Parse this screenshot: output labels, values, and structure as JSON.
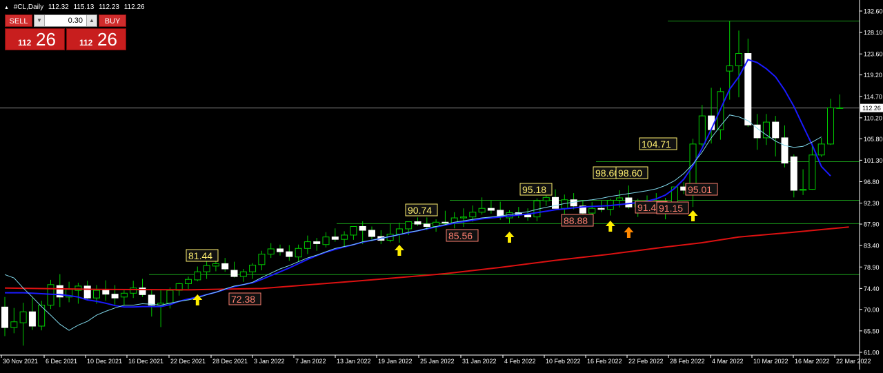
{
  "header": {
    "symbol": "#CL,Daily",
    "open": "112.32",
    "high": "115.13",
    "low": "112.23",
    "close": "112.26"
  },
  "trade_panel": {
    "sell_label": "SELL",
    "buy_label": "BUY",
    "lot": "0.30",
    "sell_price_small": "112",
    "sell_price_big": "26",
    "buy_price_small": "112",
    "buy_price_big": "26"
  },
  "chart_data": {
    "type": "candlestick",
    "symbol": "#CL",
    "timeframe": "Daily",
    "y_ticks": [
      "132.60",
      "128.10",
      "123.60",
      "119.20",
      "114.70",
      "110.20",
      "105.80",
      "101.30",
      "96.80",
      "92.30",
      "87.90",
      "83.40",
      "78.90",
      "74.40",
      "70.00",
      "65.50",
      "61.00"
    ],
    "current_price": "112.26",
    "x_ticks": [
      "30 Nov 2021",
      "6 Dec 2021",
      "10 Dec 2021",
      "16 Dec 2021",
      "22 Dec 2021",
      "28 Dec 2021",
      "3 Jan 2022",
      "7 Jan 2022",
      "13 Jan 2022",
      "19 Jan 2022",
      "25 Jan 2022",
      "31 Jan 2022",
      "4 Feb 2022",
      "10 Feb 2022",
      "16 Feb 2022",
      "22 Feb 2022",
      "28 Feb 2022",
      "4 Mar 2022",
      "10 Mar 2022",
      "16 Mar 2022",
      "22 Mar 2022"
    ],
    "candles": [
      [
        70.5,
        72.6,
        64.4,
        66.2
      ],
      [
        66.2,
        70.3,
        65.0,
        67.4
      ],
      [
        67.2,
        71.4,
        62.4,
        69.5
      ],
      [
        69.5,
        72.4,
        65.7,
        66.5
      ],
      [
        66.5,
        71.8,
        65.6,
        70.9
      ],
      [
        70.9,
        76.2,
        70.1,
        75.2
      ],
      [
        75.0,
        77.4,
        70.5,
        72.6
      ],
      [
        72.6,
        75.8,
        71.5,
        74.2
      ],
      [
        74.0,
        75.6,
        71.2,
        74.9
      ],
      [
        74.9,
        76.0,
        72.0,
        72.4
      ],
      [
        72.4,
        75.1,
        71.2,
        74.0
      ],
      [
        74.0,
        76.1,
        71.8,
        73.2
      ],
      [
        73.2,
        75.1,
        71.0,
        72.4
      ],
      [
        72.6,
        74.0,
        70.8,
        73.4
      ],
      [
        73.4,
        76.0,
        72.4,
        74.5
      ],
      [
        74.5,
        76.4,
        72.6,
        73.1
      ],
      [
        73.0,
        74.0,
        68.5,
        70.9
      ],
      [
        70.9,
        74.2,
        66.3,
        71.3
      ],
      [
        71.3,
        74.6,
        70.2,
        74.0
      ],
      [
        74.0,
        75.6,
        72.9,
        75.4
      ],
      [
        75.4,
        76.9,
        74.3,
        76.3
      ],
      [
        76.2,
        79.0,
        75.9,
        77.9
      ],
      [
        77.9,
        80.2,
        76.4,
        79.2
      ],
      [
        79.1,
        80.5,
        78.0,
        79.6
      ],
      [
        79.6,
        80.8,
        77.9,
        78.5
      ],
      [
        78.2,
        80.0,
        76.7,
        76.9
      ],
      [
        76.9,
        78.5,
        75.8,
        77.9
      ],
      [
        77.9,
        79.7,
        76.4,
        79.3
      ],
      [
        79.4,
        82.3,
        78.2,
        81.6
      ],
      [
        81.6,
        83.9,
        80.8,
        82.7
      ],
      [
        82.7,
        83.6,
        81.3,
        82.1
      ],
      [
        82.1,
        83.5,
        80.2,
        81.1
      ],
      [
        81.0,
        83.6,
        80.0,
        82.8
      ],
      [
        82.8,
        85.5,
        81.6,
        84.2
      ],
      [
        84.2,
        85.0,
        82.3,
        83.8
      ],
      [
        83.6,
        86.2,
        83.0,
        85.2
      ],
      [
        85.2,
        87.0,
        84.2,
        84.7
      ],
      [
        84.7,
        86.4,
        83.2,
        85.6
      ],
      [
        85.6,
        87.2,
        84.6,
        87.4
      ],
      [
        87.4,
        88.5,
        83.7,
        86.6
      ],
      [
        86.6,
        87.4,
        84.3,
        85.3
      ],
      [
        85.3,
        86.6,
        83.7,
        84.5
      ],
      [
        84.5,
        88.0,
        84.1,
        85.8
      ],
      [
        85.8,
        88.2,
        84.0,
        86.9
      ],
      [
        86.9,
        88.3,
        85.6,
        88.4
      ],
      [
        88.4,
        89.3,
        87.5,
        87.9
      ],
      [
        87.9,
        89.3,
        86.6,
        87.4
      ],
      [
        87.4,
        88.9,
        86.3,
        88.3
      ],
      [
        88.3,
        90.7,
        87.8,
        88.2
      ],
      [
        88.2,
        90.4,
        87.0,
        89.2
      ],
      [
        89.2,
        91.2,
        87.3,
        89.4
      ],
      [
        89.4,
        91.8,
        88.4,
        90.4
      ],
      [
        90.4,
        93.5,
        89.9,
        91.2
      ],
      [
        91.2,
        92.9,
        90.1,
        90.8
      ],
      [
        90.8,
        92.6,
        88.8,
        89.6
      ],
      [
        89.2,
        90.8,
        88.1,
        90.3
      ],
      [
        90.3,
        91.5,
        89.2,
        89.8
      ],
      [
        89.8,
        91.2,
        88.6,
        89.4
      ],
      [
        89.4,
        93.3,
        88.5,
        92.8
      ],
      [
        92.8,
        94.8,
        91.7,
        93.5
      ],
      [
        93.5,
        95.2,
        91.5,
        91.2
      ],
      [
        91.2,
        94.1,
        89.2,
        93.0
      ],
      [
        93.0,
        94.4,
        91.0,
        91.7
      ],
      [
        91.7,
        92.9,
        89.8,
        90.2
      ],
      [
        90.2,
        92.5,
        88.7,
        91.2
      ],
      [
        91.2,
        92.8,
        90.4,
        91.0
      ],
      [
        91.0,
        93.2,
        89.7,
        92.9
      ],
      [
        92.9,
        95.0,
        91.4,
        93.4
      ],
      [
        93.4,
        96.0,
        91.1,
        91.5
      ],
      [
        91.5,
        93.2,
        89.4,
        92.6
      ],
      [
        92.6,
        93.9,
        90.9,
        91.9
      ],
      [
        91.9,
        94.4,
        91.0,
        92.3
      ],
      [
        92.3,
        93.4,
        88.9,
        91.0
      ],
      [
        91.0,
        95.4,
        90.5,
        95.7
      ],
      [
        95.7,
        96.7,
        94.2,
        95.0
      ],
      [
        95.0,
        105.8,
        91.5,
        104.7
      ],
      [
        104.7,
        112.9,
        104.2,
        110.6
      ],
      [
        110.6,
        116.5,
        104.8,
        107.7
      ],
      [
        107.7,
        116.5,
        105.6,
        115.7
      ],
      [
        120.0,
        130.5,
        114.0,
        121.1
      ],
      [
        121.1,
        128.5,
        114.5,
        123.7
      ],
      [
        123.7,
        126.8,
        108.3,
        108.7
      ],
      [
        108.7,
        111.0,
        103.5,
        106.0
      ],
      [
        106.0,
        111.0,
        104.5,
        109.3
      ],
      [
        109.3,
        110.6,
        102.1,
        106.0
      ],
      [
        106.0,
        108.6,
        99.8,
        100.7
      ],
      [
        102.0,
        102.5,
        93.5,
        95.0
      ],
      [
        95.0,
        99.4,
        94.0,
        95.2
      ],
      [
        95.2,
        104.8,
        95.1,
        102.4
      ],
      [
        102.4,
        106.0,
        102.0,
        104.7
      ],
      [
        104.7,
        114.2,
        104.5,
        112.3
      ],
      [
        112.3,
        115.1,
        112.2,
        112.3
      ]
    ],
    "ma_fast": [
      [
        0,
        77.3
      ],
      [
        1,
        76.6
      ],
      [
        2,
        74.5
      ],
      [
        3,
        72.6
      ],
      [
        4,
        70.6
      ],
      [
        5,
        68.8
      ],
      [
        6,
        66.9
      ],
      [
        7,
        65.6
      ],
      [
        8,
        66.7
      ],
      [
        9,
        67.5
      ],
      [
        10,
        68.8
      ],
      [
        11,
        69.6
      ],
      [
        12,
        70.3
      ],
      [
        13,
        70.9
      ],
      [
        14,
        70.9
      ],
      [
        15,
        71.2
      ],
      [
        16,
        71.1
      ],
      [
        17,
        70.9
      ],
      [
        18,
        71.3
      ],
      [
        19,
        71.7
      ],
      [
        20,
        72.0
      ],
      [
        21,
        72.4
      ],
      [
        22,
        73.1
      ],
      [
        23,
        73.6
      ],
      [
        24,
        74.3
      ],
      [
        25,
        74.9
      ],
      [
        26,
        75.2
      ],
      [
        27,
        75.7
      ],
      [
        28,
        76.7
      ],
      [
        29,
        77.6
      ],
      [
        30,
        78.5
      ],
      [
        31,
        79.2
      ],
      [
        32,
        80.0
      ],
      [
        33,
        80.8
      ],
      [
        34,
        81.4
      ],
      [
        35,
        82.1
      ],
      [
        36,
        82.8
      ],
      [
        37,
        83.2
      ],
      [
        38,
        83.6
      ],
      [
        39,
        84.2
      ],
      [
        40,
        84.5
      ],
      [
        41,
        84.9
      ],
      [
        42,
        85.3
      ],
      [
        43,
        85.7
      ],
      [
        44,
        86.2
      ],
      [
        45,
        86.5
      ],
      [
        46,
        87.0
      ],
      [
        47,
        87.4
      ],
      [
        48,
        87.8
      ],
      [
        49,
        88.3
      ],
      [
        50,
        88.6
      ],
      [
        51,
        88.9
      ],
      [
        52,
        89.2
      ],
      [
        53,
        89.4
      ],
      [
        54,
        89.6
      ],
      [
        55,
        89.9
      ],
      [
        56,
        90.2
      ],
      [
        57,
        90.5
      ],
      [
        58,
        91.0
      ],
      [
        59,
        91.4
      ],
      [
        60,
        91.8
      ],
      [
        61,
        92.2
      ],
      [
        62,
        92.5
      ],
      [
        63,
        92.8
      ],
      [
        64,
        93.0
      ],
      [
        65,
        93.3
      ],
      [
        66,
        93.7
      ],
      [
        67,
        94.0
      ],
      [
        68,
        94.3
      ],
      [
        69,
        94.6
      ],
      [
        70,
        94.9
      ],
      [
        71,
        95.3
      ],
      [
        72,
        96.0
      ],
      [
        73,
        97.0
      ],
      [
        74,
        98.5
      ],
      [
        75,
        100.5
      ],
      [
        76,
        103.0
      ],
      [
        77,
        106.0
      ],
      [
        78,
        108.5
      ],
      [
        79,
        110.8
      ],
      [
        80,
        110.4
      ],
      [
        81,
        109.6
      ],
      [
        82,
        108.0
      ],
      [
        83,
        106.6
      ],
      [
        84,
        105.3
      ],
      [
        85,
        104.4
      ],
      [
        86,
        104.0
      ],
      [
        87,
        104.2
      ],
      [
        88,
        105.1
      ],
      [
        89,
        106.2
      ]
    ],
    "ma_blue": [
      [
        0,
        73.5
      ],
      [
        1,
        73.5
      ],
      [
        2,
        73.5
      ],
      [
        3,
        73.4
      ],
      [
        4,
        73.3
      ],
      [
        5,
        73.2
      ],
      [
        6,
        73.1
      ],
      [
        7,
        72.9
      ],
      [
        8,
        72.6
      ],
      [
        9,
        72.0
      ],
      [
        10,
        71.7
      ],
      [
        11,
        71.3
      ],
      [
        12,
        70.8
      ],
      [
        13,
        70.5
      ],
      [
        14,
        70.5
      ],
      [
        15,
        70.6
      ],
      [
        16,
        70.6
      ],
      [
        17,
        70.6
      ],
      [
        18,
        71.0
      ],
      [
        19,
        71.7
      ],
      [
        20,
        72.2
      ],
      [
        21,
        72.6
      ],
      [
        22,
        73.1
      ],
      [
        23,
        73.6
      ],
      [
        24,
        74.2
      ],
      [
        25,
        74.8
      ],
      [
        26,
        75.2
      ],
      [
        27,
        75.6
      ],
      [
        28,
        76.3
      ],
      [
        29,
        77.1
      ],
      [
        30,
        77.9
      ],
      [
        31,
        78.7
      ],
      [
        32,
        79.6
      ],
      [
        33,
        80.5
      ],
      [
        34,
        81.3
      ],
      [
        35,
        82.0
      ],
      [
        36,
        82.6
      ],
      [
        37,
        83.1
      ],
      [
        38,
        83.6
      ],
      [
        39,
        84.1
      ],
      [
        40,
        84.5
      ],
      [
        41,
        84.9
      ],
      [
        42,
        85.3
      ],
      [
        43,
        85.7
      ],
      [
        44,
        86.1
      ],
      [
        45,
        86.5
      ],
      [
        46,
        86.9
      ],
      [
        47,
        87.3
      ],
      [
        48,
        87.7
      ],
      [
        49,
        88.1
      ],
      [
        50,
        88.4
      ],
      [
        51,
        88.7
      ],
      [
        52,
        89.0
      ],
      [
        53,
        89.2
      ],
      [
        54,
        89.4
      ],
      [
        55,
        89.6
      ],
      [
        56,
        89.8
      ],
      [
        57,
        90.0
      ],
      [
        58,
        90.3
      ],
      [
        59,
        90.6
      ],
      [
        60,
        90.9
      ],
      [
        61,
        91.1
      ],
      [
        62,
        91.3
      ],
      [
        63,
        91.5
      ],
      [
        64,
        91.6
      ],
      [
        65,
        91.7
      ],
      [
        66,
        91.8
      ],
      [
        67,
        92.0
      ],
      [
        68,
        92.2
      ],
      [
        69,
        92.4
      ],
      [
        70,
        92.7
      ],
      [
        71,
        93.2
      ],
      [
        72,
        94.0
      ],
      [
        73,
        95.4
      ],
      [
        74,
        97.3
      ],
      [
        75,
        100.2
      ],
      [
        76,
        103.8
      ],
      [
        77,
        107.8
      ],
      [
        78,
        112.0
      ],
      [
        79,
        116.2
      ],
      [
        80,
        118.8
      ],
      [
        81,
        122.4
      ],
      [
        82,
        121.8
      ],
      [
        83,
        120.5
      ],
      [
        84,
        118.8
      ],
      [
        85,
        116.0
      ],
      [
        86,
        112.6
      ],
      [
        87,
        108.5
      ],
      [
        88,
        104.5
      ],
      [
        89,
        100.0
      ],
      [
        90,
        98.0
      ]
    ],
    "ma_red": [
      [
        0,
        74.5
      ],
      [
        10,
        74.2
      ],
      [
        20,
        74.1
      ],
      [
        28,
        74.4
      ],
      [
        32,
        75.0
      ],
      [
        40,
        76.2
      ],
      [
        48,
        77.5
      ],
      [
        54,
        78.8
      ],
      [
        60,
        80.3
      ],
      [
        66,
        81.6
      ],
      [
        72,
        83.1
      ],
      [
        76,
        84.0
      ],
      [
        80,
        85.2
      ],
      [
        86,
        86.2
      ],
      [
        92,
        87.3
      ]
    ],
    "hlines": [
      130.5,
      112.26,
      101.0,
      92.9,
      88.0,
      77.3
    ],
    "hline_left_start": [
      968,
      0,
      864,
      652,
      488,
      216
    ],
    "labels_yellow": [
      "81.44",
      "90.74",
      "95.18",
      "98.60",
      "98.60",
      "104.71"
    ],
    "labels_red": [
      "72.38",
      "85.56",
      "88.88",
      "91.40",
      "91.15",
      "95.01"
    ],
    "arrows": [
      {
        "color": "#ffee00",
        "at_candle": 21
      },
      {
        "color": "#ffee00",
        "at_candle": 43
      },
      {
        "color": "#ffee00",
        "at_candle": 55
      },
      {
        "color": "#ffee00",
        "at_candle": 66
      },
      {
        "color": "#ff8800",
        "at_candle": 68
      },
      {
        "color": "#ffee00",
        "at_candle": 75
      }
    ],
    "colors": {
      "bull_body": "#000000",
      "bull_border": "#00cc00",
      "bear_body": "#ffffff",
      "wick": "#00cc00",
      "ma_fast": "#7fd6e8",
      "ma_blue": "#1a1aff",
      "ma_red": "#dd1111",
      "hline": "#1a9d1a",
      "grid_text": "#ffffff",
      "label_yellow": "#ffef70",
      "label_red": "#ff8070"
    }
  }
}
